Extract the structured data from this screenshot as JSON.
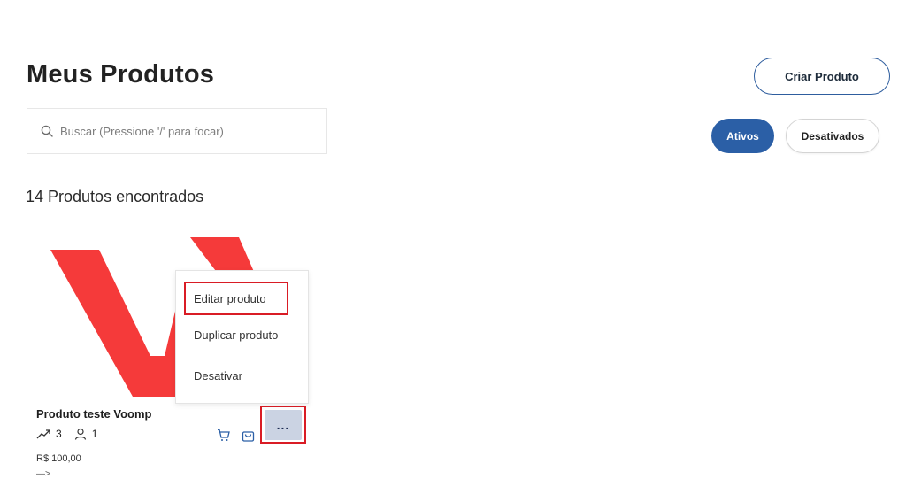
{
  "header": {
    "title": "Meus Produtos",
    "create_button": "Criar Produto"
  },
  "search": {
    "placeholder": "Buscar (Pressione '/' para focar)",
    "value": ""
  },
  "filters": {
    "active": "Ativos",
    "inactive": "Desativados",
    "selected": "Ativos"
  },
  "results": {
    "count_text": "14 Produtos encontrados"
  },
  "product": {
    "name": "Produto teste Voomp",
    "sales": "3",
    "users": "1",
    "price": "R$ 100,00",
    "extra": "—>"
  },
  "context_menu": {
    "items": [
      "Editar produto",
      "Duplicar produto",
      "Desativar"
    ]
  },
  "more_button": {
    "label": "..."
  },
  "colors": {
    "primary": "#2b5fa6",
    "highlight": "#d91c25",
    "logo_red": "#f53a3a",
    "more_bg": "#cbd3e3"
  },
  "icons": [
    "search-icon",
    "trending-up-icon",
    "user-icon",
    "cart-icon",
    "bag-icon",
    "more-icon"
  ]
}
